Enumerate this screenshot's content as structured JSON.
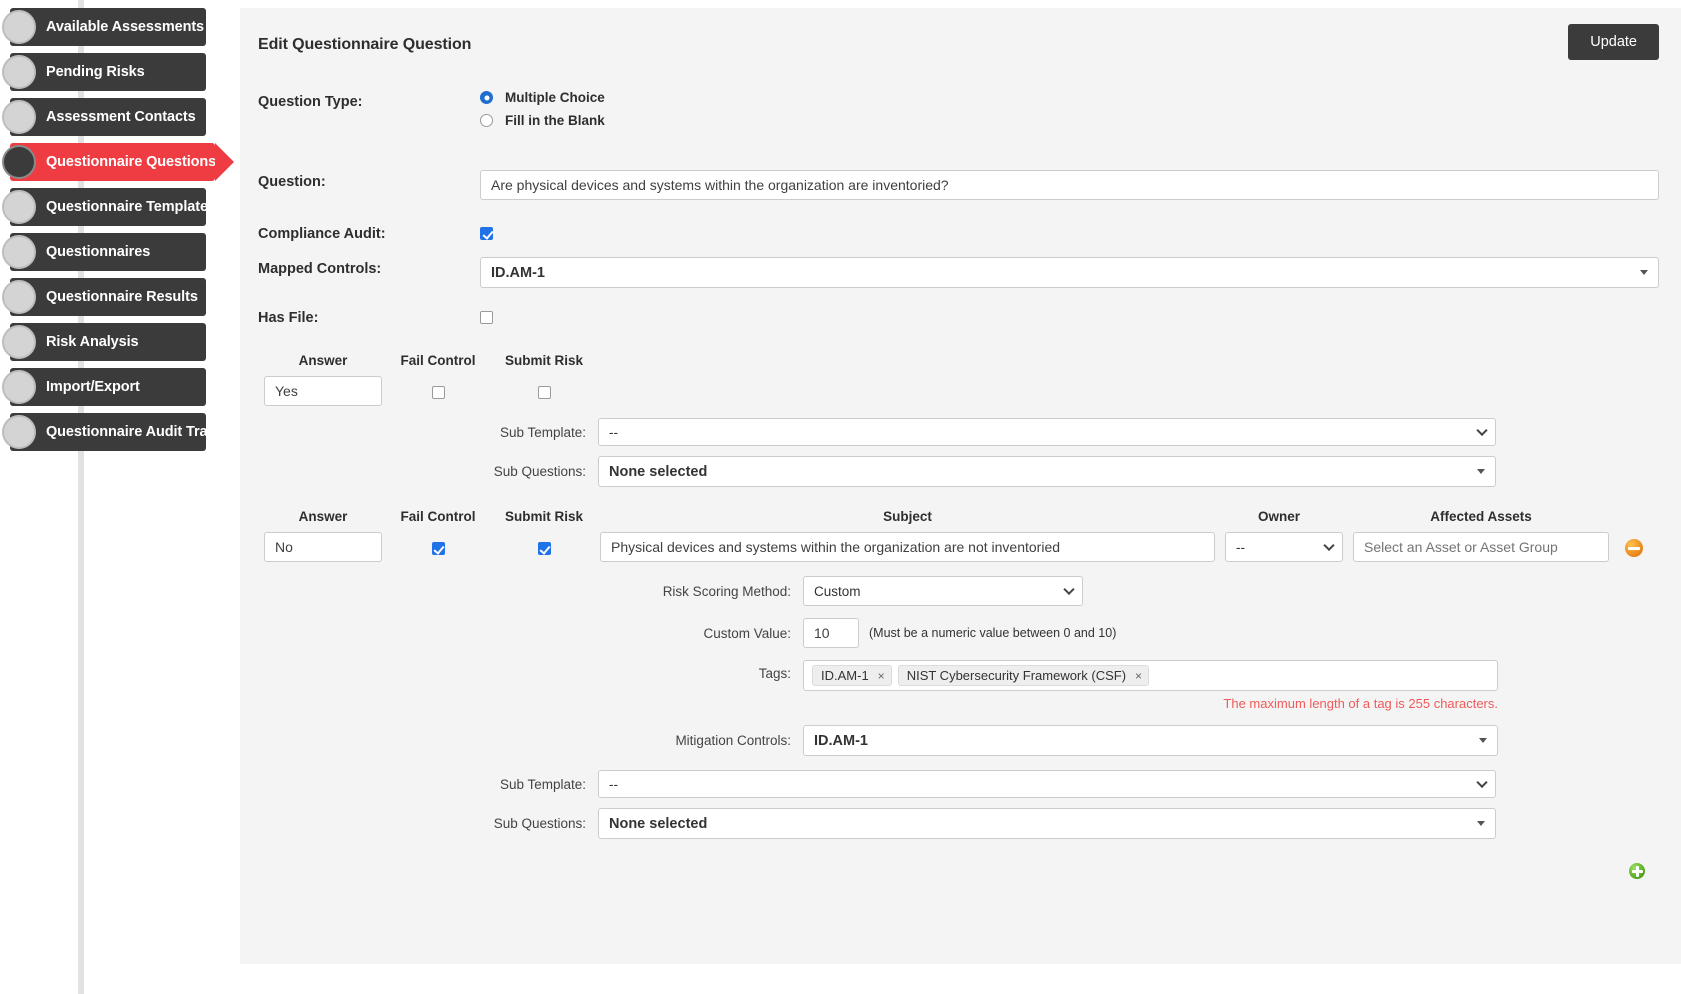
{
  "sidebar": {
    "items": [
      {
        "label": "Available Assessments",
        "active": false
      },
      {
        "label": "Pending Risks",
        "active": false
      },
      {
        "label": "Assessment Contacts",
        "active": false
      },
      {
        "label": "Questionnaire Questions",
        "active": true
      },
      {
        "label": "Questionnaire Templates",
        "active": false
      },
      {
        "label": "Questionnaires",
        "active": false
      },
      {
        "label": "Questionnaire Results",
        "active": false
      },
      {
        "label": "Risk Analysis",
        "active": false
      },
      {
        "label": "Import/Export",
        "active": false
      },
      {
        "label": "Questionnaire Audit Trail",
        "active": false
      }
    ]
  },
  "header": {
    "title": "Edit Questionnaire Question",
    "update_label": "Update"
  },
  "form": {
    "question_type_label": "Question Type:",
    "question_type_options": [
      {
        "label": "Multiple Choice",
        "selected": true
      },
      {
        "label": "Fill in the Blank",
        "selected": false
      }
    ],
    "question_label": "Question:",
    "question_value": "Are physical devices and systems within the organization are inventoried?",
    "compliance_audit_label": "Compliance Audit:",
    "compliance_audit_checked": true,
    "mapped_controls_label": "Mapped Controls:",
    "mapped_controls_value": "ID.AM-1",
    "has_file_label": "Has File:",
    "has_file_checked": false
  },
  "answers_table": {
    "headers": {
      "answer": "Answer",
      "fail_control": "Fail Control",
      "submit_risk": "Submit Risk",
      "subject": "Subject",
      "owner": "Owner",
      "affected_assets": "Affected Assets"
    },
    "sub_template_label": "Sub Template:",
    "sub_questions_label": "Sub Questions:",
    "rows": [
      {
        "answer": "Yes",
        "fail_control": false,
        "submit_risk": false,
        "sub_template_value": "--",
        "sub_questions_value": "None selected"
      },
      {
        "answer": "No",
        "fail_control": true,
        "submit_risk": true,
        "subject_value": "Physical devices and systems within the organization are not inventoried",
        "owner_value": "--",
        "assets_placeholder": "Select an Asset or Asset Group",
        "risk_scoring_method_label": "Risk Scoring Method:",
        "risk_scoring_method_value": "Custom",
        "custom_value_label": "Custom Value:",
        "custom_value": "10",
        "custom_value_hint": "(Must be a numeric value between 0 and 10)",
        "tags_label": "Tags:",
        "tags": [
          "ID.AM-1",
          "NIST Cybersecurity Framework (CSF)"
        ],
        "tags_warning": "The maximum length of a tag is 255 characters.",
        "mitigation_controls_label": "Mitigation Controls:",
        "mitigation_controls_value": "ID.AM-1",
        "sub_template_value": "--",
        "sub_questions_value": "None selected"
      }
    ]
  },
  "icons": {
    "remove_row": "minus-circle-icon",
    "add_row": "plus-circle-icon",
    "tag_remove": "×"
  },
  "colors": {
    "accent_red": "#ef3b42",
    "nav_dark": "#3b3b3b",
    "checkbox_blue": "#1f72e8",
    "warning_red": "#ef5a5a",
    "panel_bg": "#f4f4f4"
  }
}
